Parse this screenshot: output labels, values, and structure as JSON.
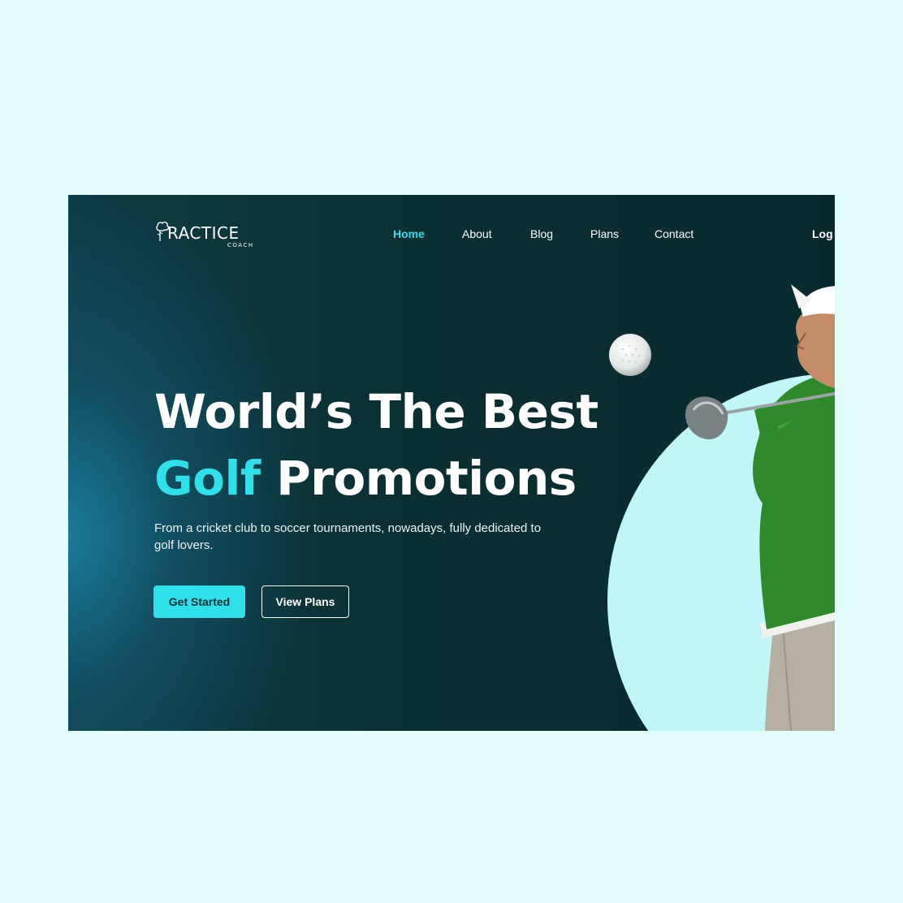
{
  "logo": {
    "word": "RACTICE",
    "sub": "COACH",
    "icon": "tree-icon"
  },
  "nav": {
    "items": [
      {
        "label": "Home",
        "active": true
      },
      {
        "label": "About",
        "active": false
      },
      {
        "label": "Blog",
        "active": false
      },
      {
        "label": "Plans",
        "active": false
      },
      {
        "label": "Contact",
        "active": false
      }
    ],
    "login_label": "Log i"
  },
  "hero": {
    "line1": "World’s The Best",
    "line2_accent": "Golf",
    "line2_rest": " Promotions",
    "lead": "From a cricket club to soccer tournaments, nowadays, fully dedicated to golf lovers.",
    "primary_button": "Get Started",
    "secondary_button": "View Plans"
  },
  "colors": {
    "page_bg": "#e3fdfd",
    "frame_bg": "#0a2f33",
    "accent": "#2fe0ea",
    "circle": "#c0f6f7",
    "shirt": "#2f8a2a"
  }
}
